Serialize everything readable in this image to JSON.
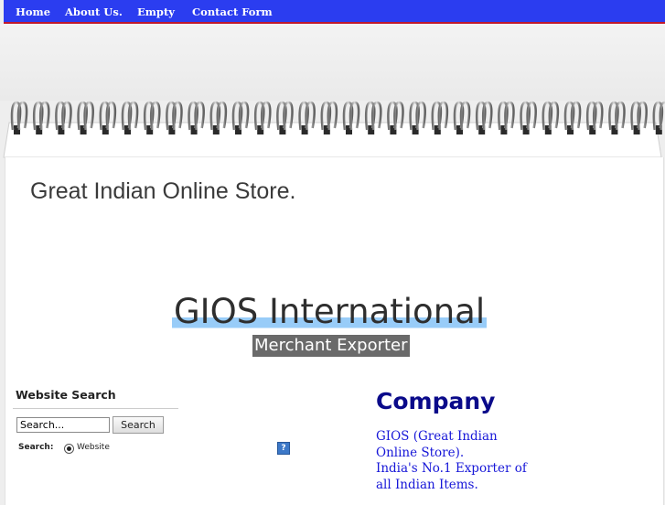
{
  "nav": {
    "home": "Home",
    "about": "About Us.",
    "empty": "Empty",
    "contact": "Contact Form"
  },
  "header": {
    "store_title": "Great Indian Online Store.",
    "brand_name": "GIOS International",
    "brand_tagline": "Merchant Exporter"
  },
  "search": {
    "title": "Website Search",
    "input_value": "Search...",
    "button_label": "Search",
    "scope_label": "Search:",
    "option_label": "Website",
    "help_glyph": "?"
  },
  "company": {
    "heading": "Company",
    "line1": "GIOS (Great Indian",
    "line2": "Online Store).",
    "line3": "India's No.1 Exporter of",
    "line4": "all Indian Items."
  },
  "colors": {
    "nav_bg": "#2b3df0",
    "nav_border": "#c0182c",
    "company_heading": "#0a0a8a",
    "company_text": "#1717d8",
    "brand_highlight": "#98ccf8"
  }
}
